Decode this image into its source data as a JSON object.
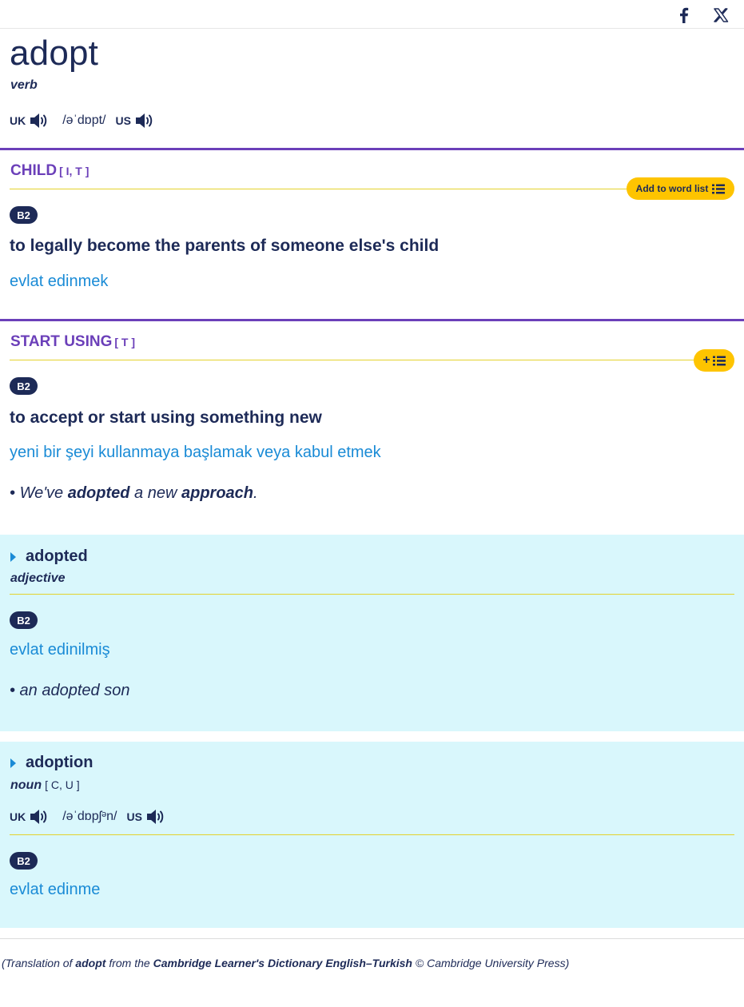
{
  "share": {
    "facebook_icon": "facebook-icon",
    "x_icon": "x-twitter-icon"
  },
  "entry": {
    "headword": "adopt",
    "pos": "verb",
    "uk_label": "UK",
    "us_label": "US",
    "ipa": "/əˈdɒpt/"
  },
  "senses": [
    {
      "guideword": "CHILD",
      "grammar": "[ I, T ]",
      "wordlist_label": "Add to word list",
      "level": "B2",
      "definition": "to legally become the parents of someone else's child",
      "translation": "evlat edinmek"
    },
    {
      "guideword": "START USING",
      "grammar": "[ T ]",
      "wordlist_plus": "+",
      "level": "B2",
      "definition": "to accept or start using something new",
      "translation": "yeni bir şeyi kullanmaya başlamak veya kabul etmek",
      "example": {
        "bullet": "•",
        "p1": "We've ",
        "b1": "adopted",
        "p2": " a new ",
        "b2": "approach",
        "p3": "."
      }
    }
  ],
  "runons": [
    {
      "word": "adopted",
      "pos": "adjective",
      "level": "B2",
      "translation": "evlat edinilmiş",
      "example": "• an adopted son"
    },
    {
      "word": "adoption",
      "pos": "noun",
      "grammar": "[ C, U ]",
      "uk_label": "UK",
      "us_label": "US",
      "ipa": "/əˈdɒpʃᵊn/",
      "level": "B2",
      "translation": "evlat edinme"
    }
  ],
  "credit": {
    "p1": "(Translation of ",
    "b1": "adopt",
    "p2": " from the ",
    "b2": "Cambridge Learner's Dictionary English–Turkish",
    "p3": " © Cambridge University Press)"
  },
  "colors": {
    "navy": "#1d2a57",
    "purple": "#6b3fb9",
    "blue_translation": "#1a8bd6",
    "yellow_button": "#fec400",
    "yellow_rule": "#e4d22e",
    "runon_bg": "#d9f7fc"
  }
}
